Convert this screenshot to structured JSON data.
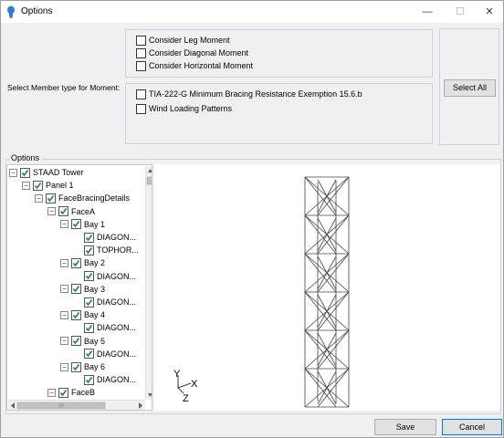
{
  "window": {
    "title": "Options",
    "minimize_icon": "minimize-icon",
    "maximize_icon": "maximize-icon",
    "close_icon": "close-icon"
  },
  "moment": {
    "label": "Select Member type for Moment:",
    "options": [
      {
        "label": "Consider Leg Moment",
        "checked": false
      },
      {
        "label": "Consider Diagonal Moment",
        "checked": false
      },
      {
        "label": "Consider Horizontal Moment",
        "checked": false
      }
    ],
    "extra_options": [
      {
        "label": "TIA-222-G Minimum Bracing Resistance Exemption 15.6.b",
        "checked": false
      },
      {
        "label": "Wind Loading Patterns",
        "checked": false
      }
    ],
    "select_all_label": "Select All"
  },
  "options_group": {
    "label": "Options",
    "tree": [
      {
        "label": "STAAD Tower",
        "level": 0,
        "expanded": true,
        "checked": true
      },
      {
        "label": "Panel 1",
        "level": 1,
        "expanded": true,
        "checked": true
      },
      {
        "label": "FaceBracingDetails",
        "level": 2,
        "expanded": true,
        "checked": true
      },
      {
        "label": "FaceA",
        "level": 3,
        "expanded": true,
        "checked": true
      },
      {
        "label": "Bay 1",
        "level": 4,
        "expanded": true,
        "checked": true
      },
      {
        "label": "DIAGON...",
        "level": 5,
        "leaf": true,
        "checked": true
      },
      {
        "label": "TOPHOR...",
        "level": 5,
        "leaf": true,
        "checked": true
      },
      {
        "label": "Bay 2",
        "level": 4,
        "expanded": true,
        "checked": true
      },
      {
        "label": "DIAGON...",
        "level": 5,
        "leaf": true,
        "checked": true
      },
      {
        "label": "Bay 3",
        "level": 4,
        "expanded": true,
        "checked": true
      },
      {
        "label": "DIAGON...",
        "level": 5,
        "leaf": true,
        "checked": true
      },
      {
        "label": "Bay 4",
        "level": 4,
        "expanded": true,
        "checked": true
      },
      {
        "label": "DIAGON...",
        "level": 5,
        "leaf": true,
        "checked": true
      },
      {
        "label": "Bay 5",
        "level": 4,
        "expanded": true,
        "checked": true
      },
      {
        "label": "DIAGON...",
        "level": 5,
        "leaf": true,
        "checked": true
      },
      {
        "label": "Bay 6",
        "level": 4,
        "expanded": true,
        "checked": true
      },
      {
        "label": "DIAGON...",
        "level": 5,
        "leaf": true,
        "checked": true
      },
      {
        "label": "FaceB",
        "level": 3,
        "expanded": true,
        "checked": true
      }
    ],
    "axes": {
      "y": "Y",
      "x": "X",
      "z": "Z"
    }
  },
  "footer": {
    "save_label": "Save",
    "cancel_label": "Cancel"
  },
  "colors": {
    "accent": "#0078d7",
    "check": "#1a7f37"
  }
}
